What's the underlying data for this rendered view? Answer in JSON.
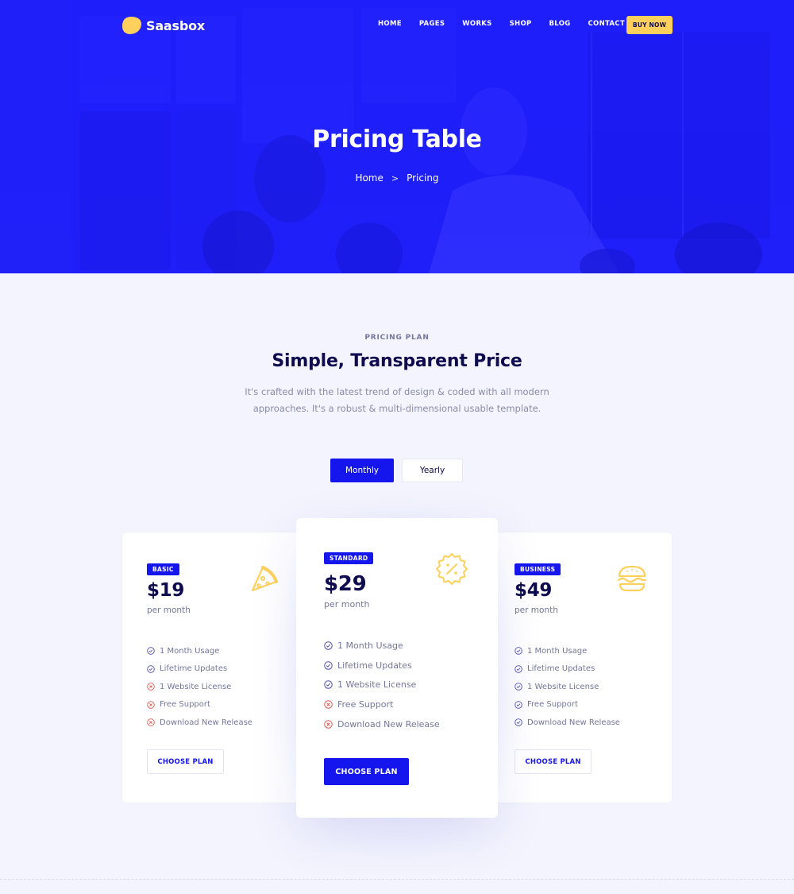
{
  "brand": {
    "name": "Saasbox"
  },
  "nav": {
    "items": [
      "HOME",
      "PAGES",
      "WORKS",
      "SHOP",
      "BLOG",
      "CONTACT"
    ],
    "cta": "BUY NOW"
  },
  "hero": {
    "title": "Pricing Table",
    "breadcrumb": {
      "home": "Home",
      "current": "Pricing",
      "separator": ">"
    }
  },
  "section": {
    "eyebrow": "PRICING PLAN",
    "title": "Simple, Transparent Price",
    "description": "It's crafted with the latest trend of design & coded with all modern approaches. It's a robust & multi-dimensional usable template."
  },
  "billing_toggle": {
    "options": [
      "Monthly",
      "Yearly"
    ],
    "selected": "Monthly"
  },
  "plans": [
    {
      "badge": "BASIC",
      "price": "$19",
      "period": "per month",
      "icon": "pizza-slice-icon",
      "features": [
        {
          "label": "1 Month Usage",
          "included": true
        },
        {
          "label": "Lifetime Updates",
          "included": true
        },
        {
          "label": "1 Website License",
          "included": false
        },
        {
          "label": "Free Support",
          "included": false
        },
        {
          "label": "Download New Release",
          "included": false
        }
      ],
      "button": "CHOOSE PLAN"
    },
    {
      "badge": "STANDARD",
      "price": "$29",
      "period": "per month",
      "icon": "discount-badge-icon",
      "features": [
        {
          "label": "1 Month Usage",
          "included": true
        },
        {
          "label": "Lifetime Updates",
          "included": true
        },
        {
          "label": "1 Website License",
          "included": true
        },
        {
          "label": "Free Support",
          "included": false
        },
        {
          "label": "Download New Release",
          "included": false
        }
      ],
      "button": "CHOOSE PLAN"
    },
    {
      "badge": "BUSINESS",
      "price": "$49",
      "period": "per month",
      "icon": "burger-icon",
      "features": [
        {
          "label": "1 Month Usage",
          "included": true
        },
        {
          "label": "Lifetime Updates",
          "included": true
        },
        {
          "label": "1 Website License",
          "included": true
        },
        {
          "label": "Free Support",
          "included": true
        },
        {
          "label": "Download New Release",
          "included": true
        }
      ],
      "button": "CHOOSE PLAN"
    }
  ],
  "colors": {
    "primary": "#1515ee",
    "hero_blue": "#1e1eff",
    "accent_yellow": "#ffd15c",
    "heading": "#0e0c4f",
    "muted": "#74769b",
    "check": "#4a4cb0",
    "cross": "#e2584f",
    "page_bg": "#f3f4fd"
  }
}
